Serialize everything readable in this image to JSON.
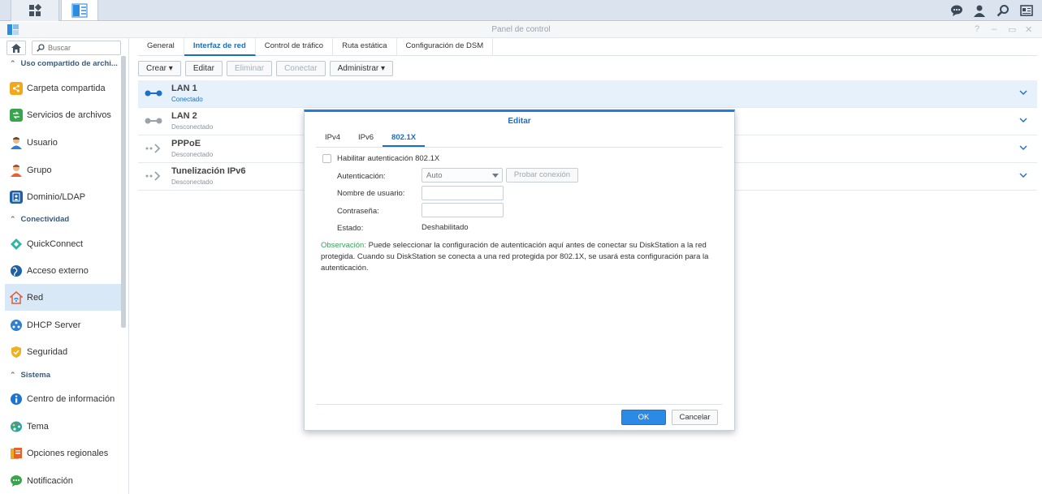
{
  "window": {
    "title": "Panel de control",
    "help": "?",
    "minimize": "–",
    "maximize": "▭",
    "close": "✕"
  },
  "search": {
    "placeholder": "Buscar"
  },
  "sidebar": {
    "sections": [
      {
        "label": "Uso compartido de archi...",
        "items": [
          {
            "label": "Carpeta compartida",
            "icon": "shared-folder-icon"
          },
          {
            "label": "Servicios de archivos",
            "icon": "file-services-icon"
          },
          {
            "label": "Usuario",
            "icon": "user-icon"
          },
          {
            "label": "Grupo",
            "icon": "group-icon"
          },
          {
            "label": "Dominio/LDAP",
            "icon": "domain-ldap-icon"
          }
        ]
      },
      {
        "label": "Conectividad",
        "items": [
          {
            "label": "QuickConnect",
            "icon": "quickconnect-icon"
          },
          {
            "label": "Acceso externo",
            "icon": "external-access-icon"
          },
          {
            "label": "Red",
            "icon": "network-icon"
          },
          {
            "label": "DHCP Server",
            "icon": "dhcp-icon"
          },
          {
            "label": "Seguridad",
            "icon": "security-icon"
          }
        ]
      },
      {
        "label": "Sistema",
        "items": [
          {
            "label": "Centro de información",
            "icon": "info-icon"
          },
          {
            "label": "Tema",
            "icon": "theme-icon"
          },
          {
            "label": "Opciones regionales",
            "icon": "regional-icon"
          },
          {
            "label": "Notificación",
            "icon": "notification-icon"
          }
        ]
      }
    ]
  },
  "tabs": [
    "General",
    "Interfaz de red",
    "Control de tráfico",
    "Ruta estática",
    "Configuración de DSM"
  ],
  "toolbar": {
    "create": "Crear ▾",
    "edit": "Editar",
    "delete": "Eliminar",
    "connect": "Conectar",
    "manage": "Administrar ▾"
  },
  "interfaces": [
    {
      "name": "LAN 1",
      "status": "Conectado"
    },
    {
      "name": "LAN 2",
      "status": "Desconectado"
    },
    {
      "name": "PPPoE",
      "status": "Desconectado"
    },
    {
      "name": "Tunelización IPv6",
      "status": "Desconectado"
    }
  ],
  "dialog": {
    "title": "Editar",
    "tabs": [
      "IPv4",
      "IPv6",
      "802.1X"
    ],
    "enable_label": "Habilitar autenticación 802.1X",
    "auth_label": "Autenticación:",
    "auth_value": "Auto",
    "test_button": "Probar conexión",
    "username_label": "Nombre de usuario:",
    "password_label": "Contraseña:",
    "state_label": "Estado:",
    "state_value": "Deshabilitado",
    "note_prefix": "Observación:",
    "note_text": " Puede seleccionar la configuración de autenticación aquí antes de conectar su DiskStation a la red protegida. Cuando su DiskStation se conecta a una red protegida por 802.1X, se usará esta configuración para la autenticación.",
    "ok": "OK",
    "cancel": "Cancelar"
  }
}
